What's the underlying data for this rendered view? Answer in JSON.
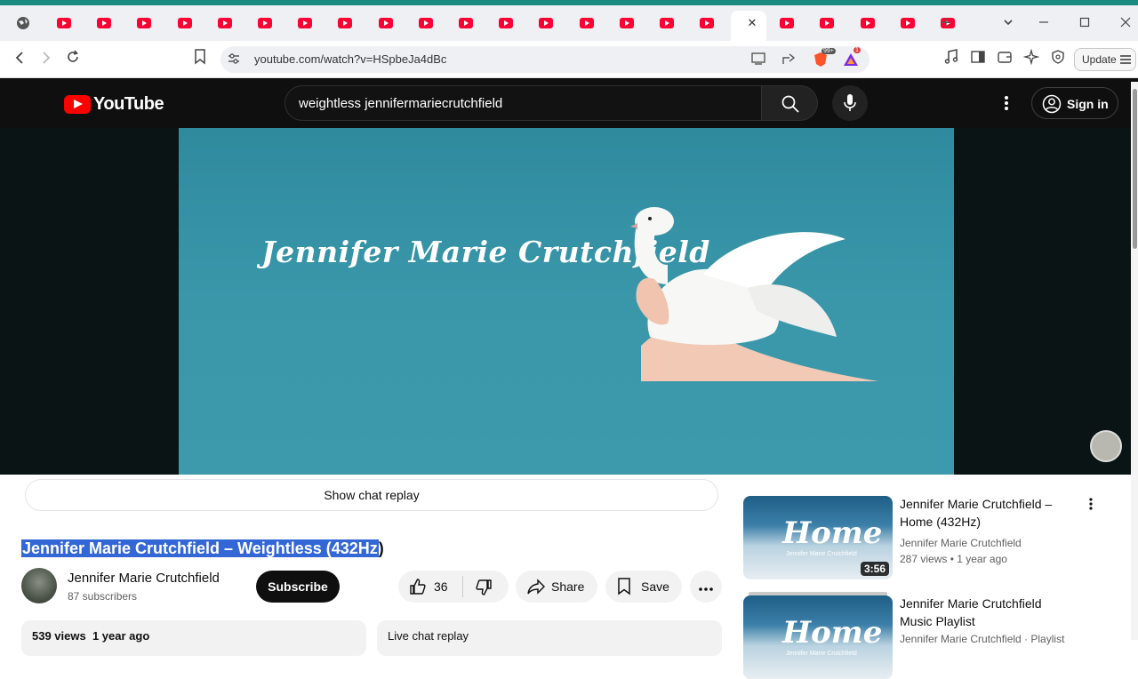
{
  "browser": {
    "tab_count_icons": 22,
    "active_tab_close": "✕",
    "new_tab": "+",
    "url": "youtube.com/watch?v=HSpbeJa4dBc",
    "update_label": "Update",
    "brave_badge": "99+",
    "rewards_badge": "1"
  },
  "youtube": {
    "logo_text": "YouTube",
    "search_value": "weightless jennifermariecrutchfield",
    "signin_label": "Sign in"
  },
  "player": {
    "overlay_title": "Jennifer Marie Crutchfield"
  },
  "chat": {
    "show_replay_label": "Show chat replay"
  },
  "video": {
    "title_selected": "Jennifer Marie Crutchfield – Weightless (432Hz",
    "title_rest": ")",
    "channel_name": "Jennifer Marie Crutchfield",
    "subscribers": "87 subscribers",
    "subscribe_label": "Subscribe",
    "likes": "36",
    "share_label": "Share",
    "save_label": "Save",
    "views_info": "539 views  1 year ago",
    "live_chat_label": "Live chat replay"
  },
  "recommendations": [
    {
      "thumb_word": "Home",
      "thumb_sub": "Jennifer Marie Crutchfield",
      "duration": "3:56",
      "title": "Jennifer Marie Crutchfield – Home (432Hz)",
      "channel": "Jennifer Marie Crutchfield",
      "meta": "287 views  • 1 year ago"
    },
    {
      "thumb_word": "Home",
      "thumb_sub": "Jennifer Marie Crutchfield",
      "title": "Jennifer Marie Crutchfield Music Playlist",
      "channel": "Jennifer Marie Crutchfield · Playlist"
    }
  ],
  "colors": {
    "accent_red": "#ff0000",
    "selection": "#3367d6",
    "header_bg": "#0f0f0f"
  }
}
